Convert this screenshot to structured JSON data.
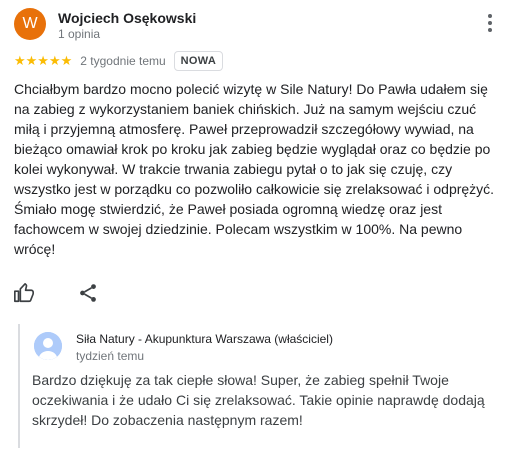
{
  "review": {
    "avatar_letter": "W",
    "author_name": "Wojciech Osękowski",
    "author_meta": "1 opinia",
    "stars": "★★★★★",
    "rating": 5,
    "date": "2 tygodnie temu",
    "badge": "NOWA",
    "text": "Chciałbym bardzo mocno polecić wizytę w Sile Natury! Do Pawła udałem się na zabieg z wykorzystaniem baniek chińskich. Już na samym wejściu czuć miłą i przyjemną atmosferę. Paweł przeprowadził szczegółowy wywiad, na bieżąco omawiał krok po kroku jak zabieg będzie wyglądał oraz co będzie po kolei wykonywał. W trakcie trwania zabiegu pytał o to jak się czuję, czy wszystko jest w porządku co pozwoliło całkowicie się zrelaksować i odprężyć. Śmiało mogę stwierdzić, że Paweł posiada ogromną wiedzę oraz jest fachowcem w swojej dziedzinie. Polecam wszystkim w 100%. Na pewno wrócę!"
  },
  "icons": {
    "more": "more-vert-icon",
    "like": "thumb-up-icon",
    "share": "share-icon",
    "owner_avatar": "person-avatar-icon"
  },
  "owner_reply": {
    "owner_name": "Siła Natury - Akupunktura Warszawa (właściciel)",
    "date": "tydzień temu",
    "text": "Bardzo dziękuję za tak ciepłe słowa! Super, że zabieg spełnił Twoje oczekiwania i że udało Ci się zrelaksować. Takie opinie naprawdę dodają skrzydeł! Do zobaczenia następnym razem!"
  },
  "colors": {
    "avatar_bg": "#e8710a",
    "star": "#fbbc04",
    "owner_avatar_bg": "#aecbfa"
  }
}
